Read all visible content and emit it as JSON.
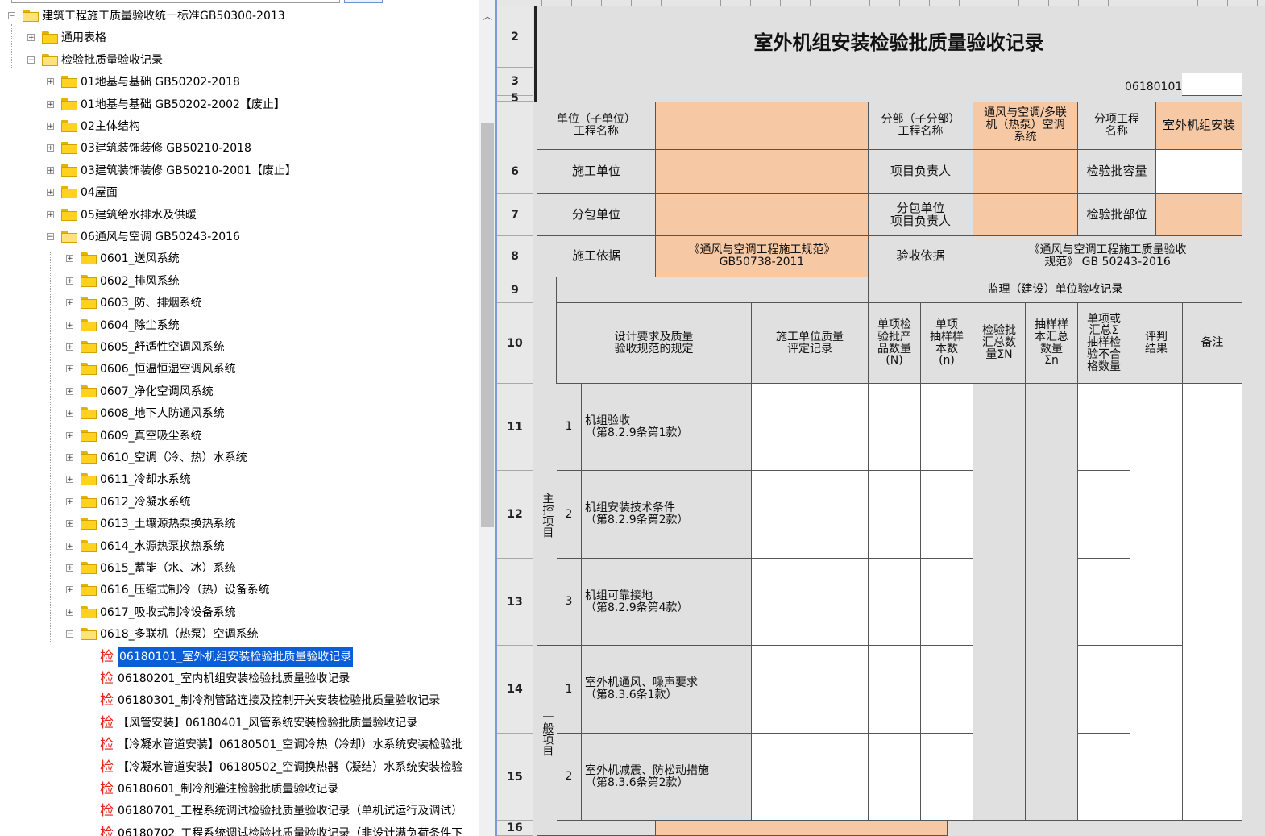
{
  "tree": {
    "root": "建筑工程施工质量验收统一标准GB50300-2013",
    "general": "通用表格",
    "inspection_records": "检验批质量验收记录",
    "sections": [
      "01地基与基础 GB50202-2018",
      "01地基与基础 GB50202-2002【废止】",
      "02主体结构",
      "03建筑装饰装修 GB50210-2018",
      "03建筑装饰装修 GB50210-2001【废止】",
      "04屋面",
      "05建筑给水排水及供暖",
      "06通风与空调 GB50243-2016"
    ],
    "subsystems": [
      "0601_送风系统",
      "0602_排风系统",
      "0603_防、排烟系统",
      "0604_除尘系统",
      "0605_舒适性空调风系统",
      "0606_恒温恒湿空调风系统",
      "0607_净化空调风系统",
      "0608_地下人防通风系统",
      "0609_真空吸尘系统",
      "0610_空调（冷、热）水系统",
      "0611_冷却水系统",
      "0612_冷凝水系统",
      "0613_土壤源热泵换热系统",
      "0614_水源热泵换热系统",
      "0615_蓄能（水、冰）系统",
      "0616_压缩式制冷（热）设备系统",
      "0617_吸收式制冷设备系统",
      "0618_多联机（热泵）空调系统"
    ],
    "leaf_icon": "检",
    "leaves": [
      "06180101_室外机组安装检验批质量验收记录",
      "06180201_室内机组安装检验批质量验收记录",
      "06180301_制冷剂管路连接及控制开关安装检验批质量验收记录",
      "【风管安装】06180401_风管系统安装检验批质量验收记录",
      "【冷凝水管道安装】06180501_空调冷热（冷却）水系统安装检验批",
      "【冷凝水管道安装】06180502_空调换热器（凝结）水系统安装检验",
      "06180601_制冷剂灌注检验批质量验收记录",
      "06180701_工程系统调试检验批质量验收记录（单机试运行及调试）",
      "06180702_工程系统调试检验批质量验收记录（非设计满负荷条件下"
    ],
    "selected_leaf": 0
  },
  "sheet": {
    "title": "室外机组安装检验批质量验收记录",
    "doc_no": "06180101",
    "row_numbers": [
      "2",
      "3",
      "5",
      "6",
      "7",
      "8",
      "9",
      "10",
      "11",
      "12",
      "13",
      "14",
      "15",
      "16"
    ],
    "header": {
      "unit_name": "单位（子单位）\n工程名称",
      "division_name": "分部（子分部）\n工程名称",
      "division_value": "通风与空调/多联\n机（热泵）空调\n系统",
      "item_name": "分项工程\n名称",
      "item_value": "室外机组安装",
      "contractor": "施工单位",
      "project_manager": "项目负责人",
      "batch_capacity": "检验批容量",
      "subcontractor": "分包单位",
      "sub_manager": "分包单位\n项目负责人",
      "batch_location": "检验批部位",
      "construction_basis": "施工依据",
      "construction_basis_value": "《通风与空调工程施工规范》\nGB50738-2011",
      "acceptance_basis": "验收依据",
      "acceptance_basis_value": "《通风与空调工程施工质量验收\n规范》 GB 50243-2016"
    },
    "columns": {
      "supervision": "监理（建设）单位验收记录",
      "design_req": "设计要求及质量\n验收规范的规定",
      "self_check": "施工单位质量\n评定记录",
      "n_products": "单项检\n验批产\n品数量\n(N)",
      "n_samples": "单项\n抽样样\n本数\n(n)",
      "sum_n": "检验批\n汇总数\n量ΣN",
      "sum_samples": "抽样样\n本汇总\n数量\nΣn",
      "nonconform": "单项或\n汇总Σ\n抽样检\n验不合\n格数量",
      "result": "评判\n结果",
      "remark": "备注"
    },
    "main_label": "主控项目",
    "general_label": "一般项目",
    "main_items": [
      {
        "no": "1",
        "text": "机组验收\n（第8.2.9条第1款）"
      },
      {
        "no": "2",
        "text": "机组安装技术条件\n（第8.2.9条第2款）"
      },
      {
        "no": "3",
        "text": "机组可靠接地\n（第8.2.9条第4款）"
      }
    ],
    "general_items": [
      {
        "no": "1",
        "text": "室外机通风、噪声要求\n（第8.3.6条1款）"
      },
      {
        "no": "2",
        "text": "室外机减震、防松动措施\n（第8.3.6条第2款）"
      }
    ]
  },
  "colors": {
    "accent_orange": "#f6c8a4",
    "selection": "#0a5ed7",
    "leaf_icon": "#e8231a"
  }
}
